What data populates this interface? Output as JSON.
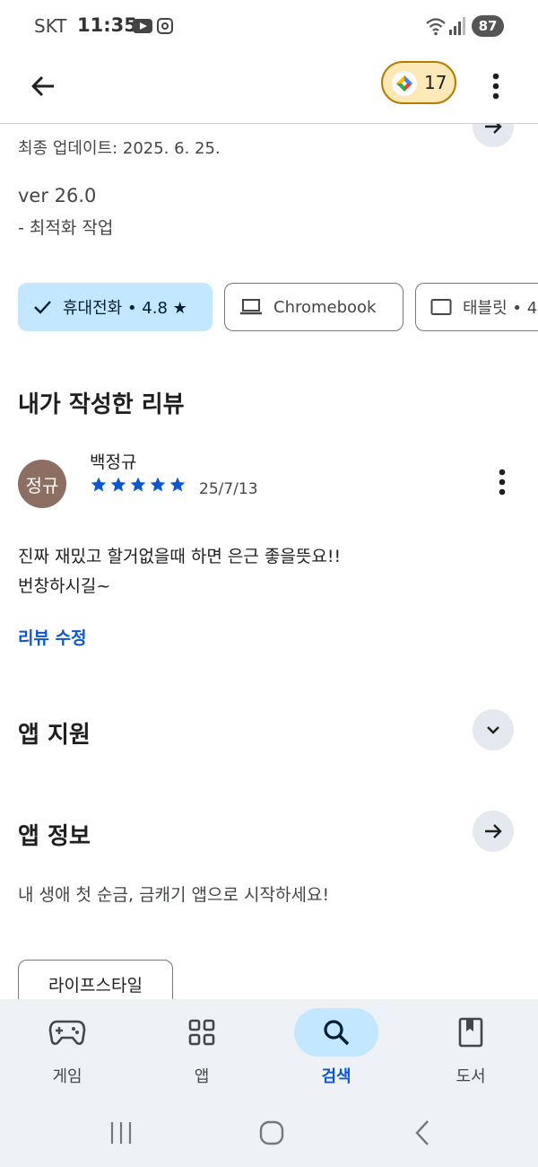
{
  "status_bar": {
    "carrier": "SKT",
    "time": "11:35",
    "battery": "87"
  },
  "header": {
    "points": "17"
  },
  "details": {
    "last_updated": "최종 업데이트: 2025. 6. 25.",
    "version": "ver 26.0",
    "change_note": "- 최적화 작업"
  },
  "device_chips": [
    {
      "label": "휴대전화 • 4.8 ★",
      "selected": true
    },
    {
      "label": "Chromebook",
      "selected": false
    },
    {
      "label": "태블릿 • 4",
      "selected": false
    }
  ],
  "my_review": {
    "title": "내가 작성한 리뷰",
    "avatar_text": "정규",
    "reviewer": "백정규",
    "rating": 5,
    "date": "25/7/13",
    "text": "진짜 재밌고 할거없을때 하면 은근 좋을뜻요!!\n번창하시길~",
    "edit_label": "리뷰 수정"
  },
  "app_support": {
    "title": "앱 지원"
  },
  "app_info": {
    "title": "앱 정보",
    "description": "내 생애 첫 순금, 금캐기 앱으로 시작하세요!",
    "category": "라이프스타일"
  },
  "bottom_nav": [
    {
      "label": "게임",
      "icon": "gamepad-icon",
      "active": false
    },
    {
      "label": "앱",
      "icon": "apps-grid-icon",
      "active": false
    },
    {
      "label": "검색",
      "icon": "search-icon",
      "active": true
    },
    {
      "label": "도서",
      "icon": "book-icon",
      "active": false
    }
  ],
  "colors": {
    "accent_blue": "#0b57d0",
    "chip_selected_bg": "#c2e7ff",
    "star_blue": "#0b57d0",
    "avatar_brown": "#8d6e63",
    "points_chip_bg": "#fde9b7"
  }
}
